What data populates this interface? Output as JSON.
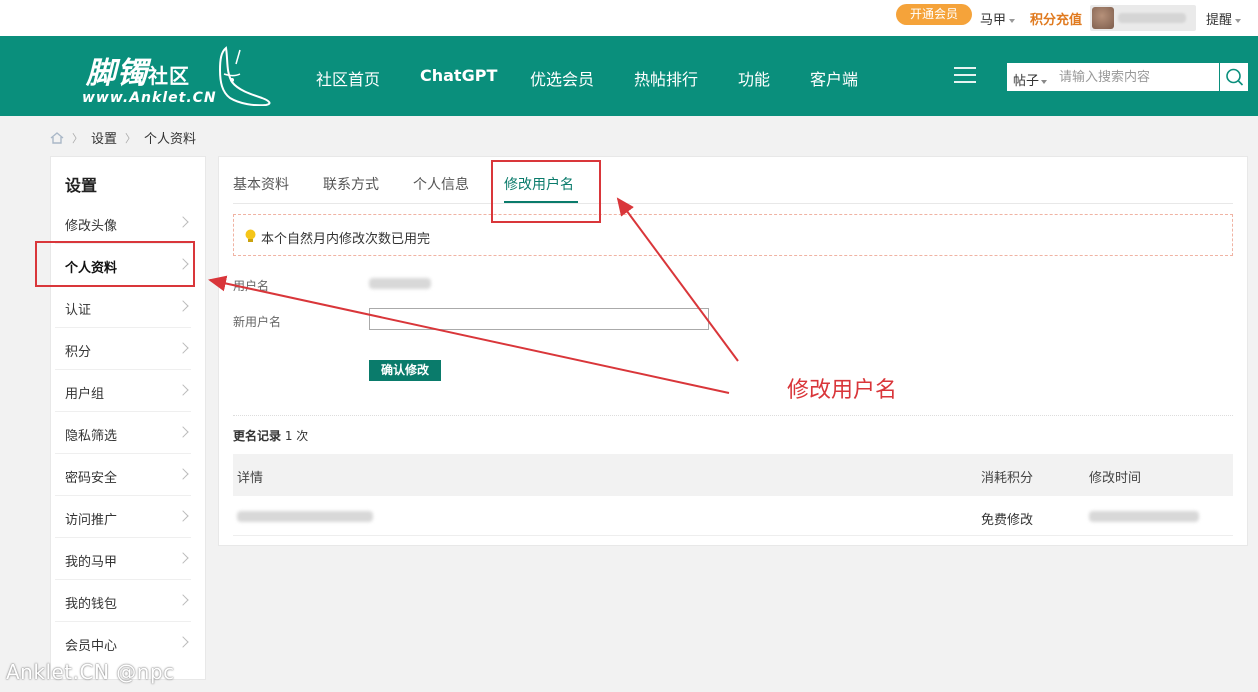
{
  "topbar": {
    "vip_label": "开通会员",
    "alt_account": "马甲",
    "recharge": "积分充值",
    "remind": "提醒"
  },
  "header": {
    "logo_cn": "脚镯",
    "logo_cn_small": "社区",
    "logo_en": "www.Anklet.CN",
    "nav": [
      "社区首页",
      "ChatGPT",
      "优选会员",
      "热帖排行",
      "功能",
      "客户端"
    ],
    "search_type": "帖子",
    "search_placeholder": "请输入搜索内容"
  },
  "breadcrumb": [
    "设置",
    "个人资料"
  ],
  "sidebar": {
    "title": "设置",
    "items": [
      "修改头像",
      "个人资料",
      "认证",
      "积分",
      "用户组",
      "隐私筛选",
      "密码安全",
      "访问推广",
      "我的马甲",
      "我的钱包",
      "会员中心"
    ],
    "active_index": 1
  },
  "main": {
    "tabs": [
      "基本资料",
      "联系方式",
      "个人信息",
      "修改用户名"
    ],
    "active_tab": 3,
    "notice": "本个自然月内修改次数已用完",
    "username_label": "用户名",
    "new_username_label": "新用户名",
    "confirm_label": "确认修改",
    "record_title": "更名记录",
    "record_count": "1 次",
    "table": {
      "headers": [
        "详情",
        "消耗积分",
        "修改时间"
      ],
      "rows": [
        {
          "cost": "免费修改"
        }
      ]
    }
  },
  "annotation": {
    "text": "修改用户名",
    "color": "#d9363a"
  },
  "watermark": "Anklet.CN @npc",
  "colors": {
    "brand": "#0a8f7c",
    "accent_orange": "#f5a33a",
    "annotation_red": "#d9363a"
  }
}
